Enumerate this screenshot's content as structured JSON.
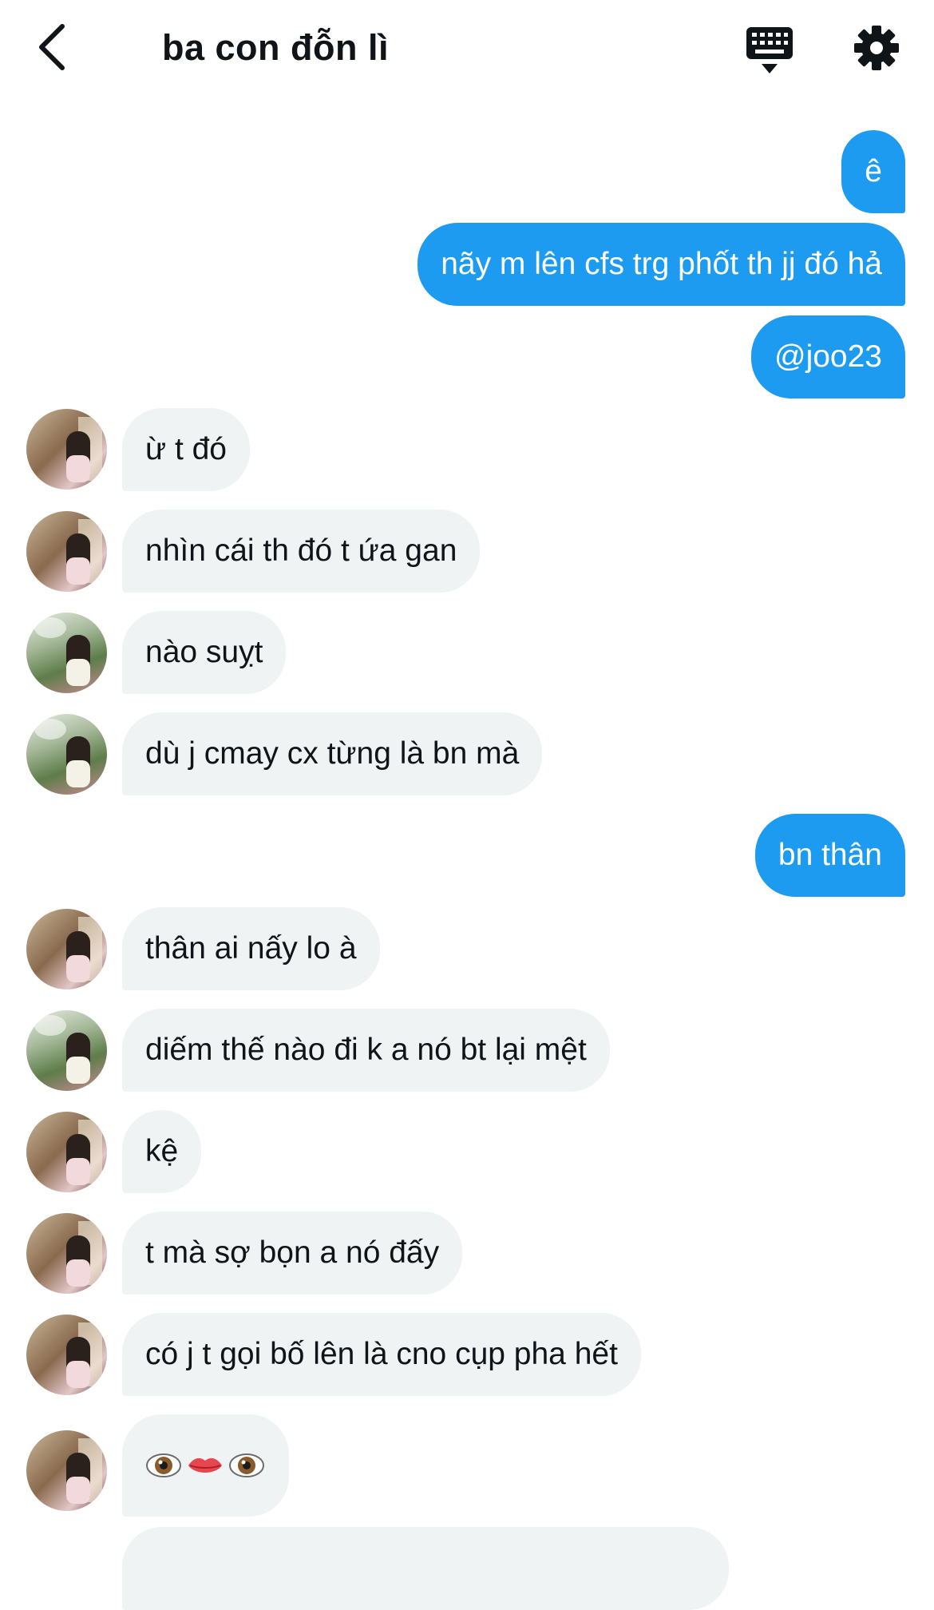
{
  "header": {
    "title": "ba con đỗn lì",
    "back_icon": "chevron-left-icon",
    "keyboard_icon": "keyboard-icon",
    "settings_icon": "gear-icon"
  },
  "colors": {
    "outgoing_bubble": "#1d9bf0",
    "incoming_bubble": "#eff3f4"
  },
  "messages": [
    {
      "direction": "out",
      "text": "ê"
    },
    {
      "direction": "out",
      "text": "nãy m lên cfs trg phốt th jj đó hả"
    },
    {
      "direction": "out",
      "text": "@joo23"
    },
    {
      "direction": "in",
      "avatar": "brown",
      "text": "ừ t đó"
    },
    {
      "direction": "in",
      "avatar": "brown",
      "text": "nhìn cái th đó t ứa gan"
    },
    {
      "direction": "in",
      "avatar": "green",
      "text": "nào suỵt"
    },
    {
      "direction": "in",
      "avatar": "green",
      "text": "dù j cmay cx từng là bn mà"
    },
    {
      "direction": "out",
      "text": "bn thân"
    },
    {
      "direction": "in",
      "avatar": "brown",
      "text": "thân ai nấy lo à"
    },
    {
      "direction": "in",
      "avatar": "green",
      "text": "diếm thế nào đi k a nó bt lại mệt"
    },
    {
      "direction": "in",
      "avatar": "brown",
      "text": "kệ"
    },
    {
      "direction": "in",
      "avatar": "brown",
      "text": "t mà sợ bọn a nó đấy"
    },
    {
      "direction": "in",
      "avatar": "brown",
      "text": "có j t gọi bố lên là cno cụp pha hết"
    },
    {
      "direction": "in",
      "avatar": "brown",
      "emoji": [
        "eye-icon",
        "lips-icon",
        "eye-icon"
      ]
    }
  ]
}
